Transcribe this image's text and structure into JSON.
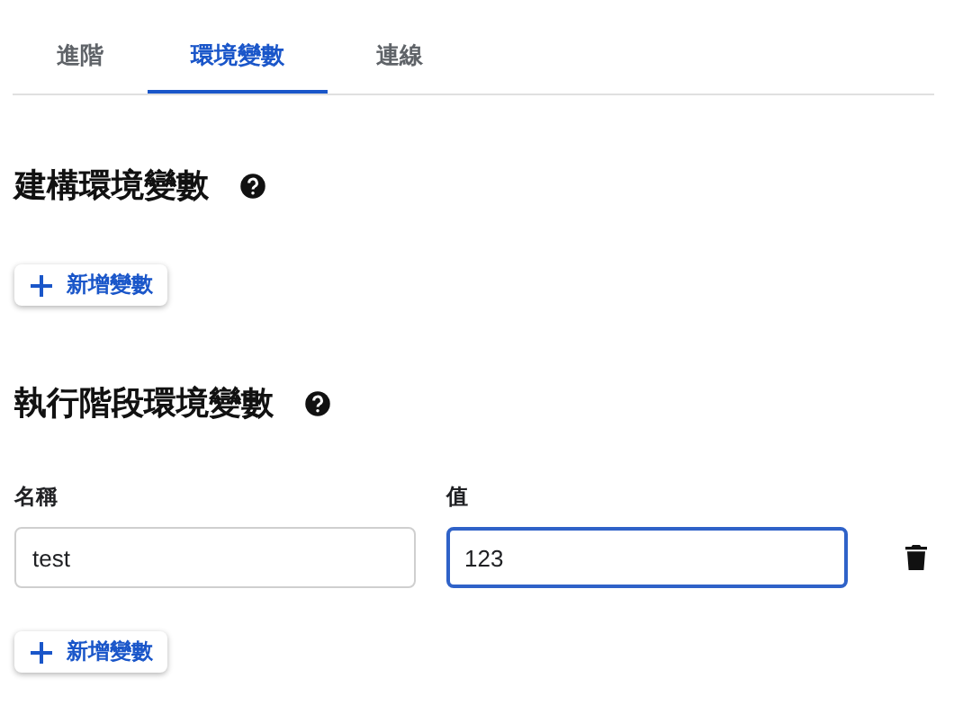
{
  "tabs": [
    {
      "label": "進階",
      "selected": false
    },
    {
      "label": "環境變數",
      "selected": true
    },
    {
      "label": "連線",
      "selected": false
    }
  ],
  "sections": [
    {
      "title": "建構環境變數",
      "add_button": "新增變數"
    },
    {
      "title": "執行階段環境變數",
      "columns": [
        "名稱",
        "值"
      ],
      "variables": [
        {
          "name": {
            "value": "test",
            "focused": false
          },
          "value": {
            "value": "123",
            "focused": true
          }
        }
      ],
      "add_button": "新增變數"
    }
  ]
}
